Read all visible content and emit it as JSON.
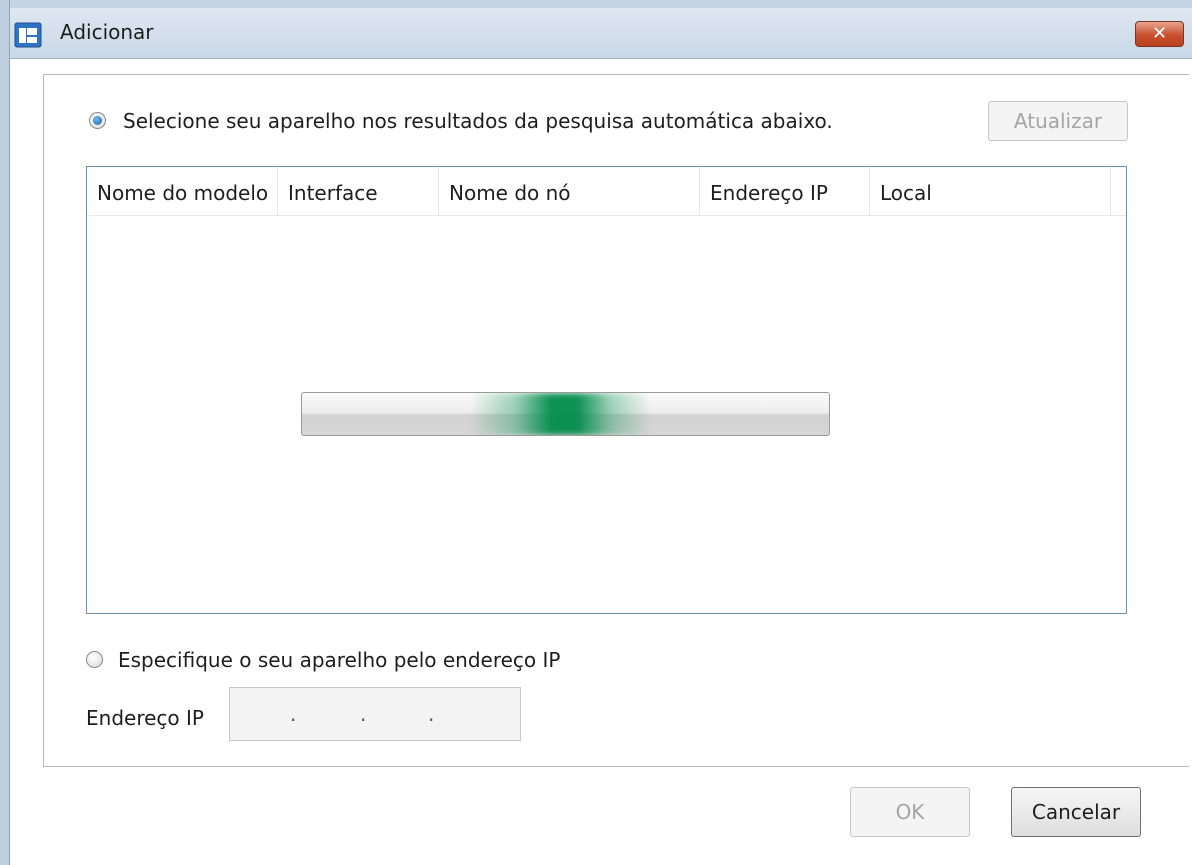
{
  "window": {
    "title": "Adicionar",
    "close_label": "✕",
    "icon": "printer-window-icon"
  },
  "search": {
    "radio_label": "Selecione seu aparelho nos resultados da pesquisa automática abaixo.",
    "radio_selected": true,
    "refresh_label": "Atualizar",
    "refresh_enabled": false
  },
  "device_list": {
    "columns": [
      "Nome do modelo",
      "Interface",
      "Nome do nó",
      "Endereço IP",
      "Local"
    ],
    "rows": [],
    "progress": {
      "state": "searching",
      "indeterminate": true,
      "color": "#008c4b"
    }
  },
  "manual": {
    "radio_label": "Especifique o seu aparelho pelo endereço IP",
    "radio_selected": false,
    "ip_label": "Endereço IP",
    "ip_separators": [
      ".",
      ".",
      "."
    ],
    "ip_enabled": false
  },
  "footer": {
    "ok_label": "OK",
    "ok_enabled": false,
    "cancel_label": "Cancelar"
  }
}
